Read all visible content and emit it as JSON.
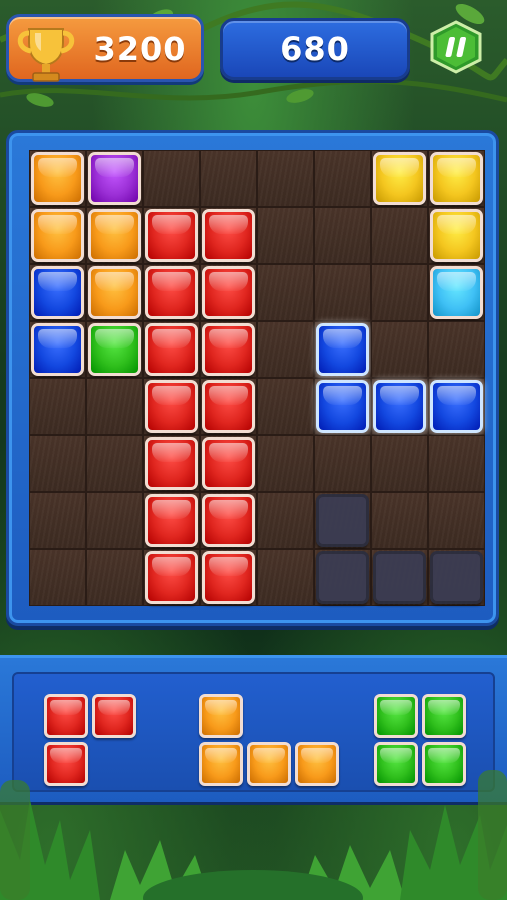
{
  "header": {
    "best_score": "3200",
    "current_score": "680",
    "pause_icon": "pause-icon",
    "trophy_icon": "trophy-icon"
  },
  "colors": {
    "orange": "#f89a1a",
    "purple": "#9b2fd6",
    "red": "#e0261f",
    "blue": "#1348e0",
    "green": "#2fbf1c",
    "yellow": "#f4c61f",
    "cyan": "#3fc0f5",
    "ghost": "#3b3d55"
  },
  "board": {
    "rows": 8,
    "cols": 8,
    "cells": [
      [
        "orange",
        "purple",
        "",
        "",
        "",
        "",
        "yellow",
        "yellow"
      ],
      [
        "orange",
        "orange",
        "red",
        "red",
        "",
        "",
        "",
        "yellow"
      ],
      [
        "blue",
        "orange",
        "red",
        "red",
        "",
        "",
        "",
        "cyan"
      ],
      [
        "blue",
        "green",
        "red",
        "red",
        "",
        "blue-placed",
        "",
        ""
      ],
      [
        "",
        "",
        "red",
        "red",
        "",
        "blue-placed",
        "blue-placed",
        "blue-placed"
      ],
      [
        "",
        "",
        "red",
        "red",
        "",
        "",
        "",
        ""
      ],
      [
        "",
        "",
        "red",
        "red",
        "",
        "ghost",
        "",
        ""
      ],
      [
        "",
        "",
        "red",
        "red",
        "",
        "ghost",
        "ghost",
        "ghost"
      ]
    ]
  },
  "tray": {
    "pieces": [
      {
        "name": "tray-piece-red-corner",
        "color": "red",
        "blocks": [
          [
            0,
            0
          ],
          [
            1,
            0
          ],
          [
            0,
            1
          ]
        ]
      },
      {
        "name": "tray-piece-orange-l",
        "color": "orange",
        "blocks": [
          [
            0,
            0
          ],
          [
            0,
            1
          ],
          [
            1,
            1
          ],
          [
            2,
            1
          ]
        ]
      },
      {
        "name": "tray-piece-green-square",
        "color": "green",
        "blocks": [
          [
            0,
            0
          ],
          [
            1,
            0
          ],
          [
            0,
            1
          ],
          [
            1,
            1
          ]
        ]
      }
    ]
  }
}
